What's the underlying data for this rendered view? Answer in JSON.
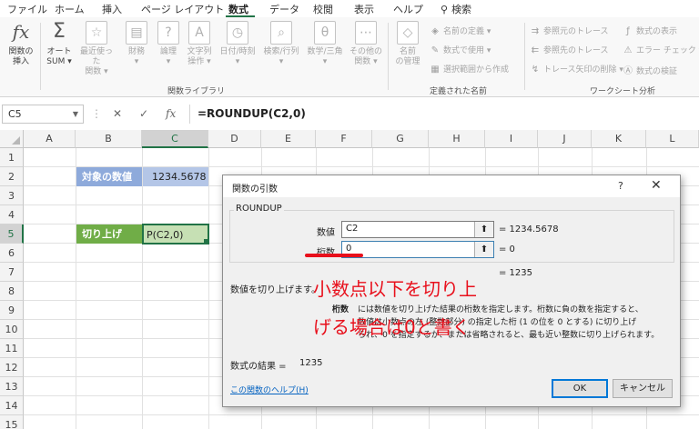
{
  "menu": {
    "tabs": [
      "ファイル",
      "ホーム",
      "挿入",
      "ページ レイアウト",
      "数式",
      "データ",
      "校閲",
      "表示",
      "ヘルプ"
    ],
    "active_tab": "数式",
    "search_label": "検索"
  },
  "ribbon": {
    "insert_function": "関数の\n挿入",
    "autosum": "オート\nSUM ▾",
    "recent": "最近使った\n関数 ▾",
    "financial": "財務\n▾",
    "logical": "論理\n▾",
    "text": "文字列\n操作 ▾",
    "datetime": "日付/時刻\n▾",
    "lookup": "検索/行列\n▾",
    "math": "数学/三角\n▾",
    "more": "その他の\n関数 ▾",
    "library_label": "関数ライブラリ",
    "name_manager": "名前\nの管理",
    "define_name": "名前の定義 ▾",
    "use_in_formula": "数式で使用 ▾",
    "create_from_selection": "選択範囲から作成",
    "defined_names_label": "定義された名前",
    "trace_precedents": "参照元のトレース",
    "trace_dependents": "参照先のトレース",
    "remove_arrows": "トレース矢印の削除 ▾",
    "show_formulas": "数式の表示",
    "error_checking": "エラー チェック ▾",
    "evaluate_formula": "数式の検証",
    "auditing_label": "ワークシート分析"
  },
  "formula_bar": {
    "name_box": "C5",
    "cancel": "✕",
    "enter": "✓",
    "fx": "fx",
    "formula": "=ROUNDUP(C2,0)"
  },
  "grid": {
    "columns": [
      "A",
      "B",
      "C",
      "D",
      "E",
      "F",
      "G",
      "H",
      "I",
      "J",
      "K",
      "L"
    ],
    "rows": [
      "1",
      "2",
      "3",
      "4",
      "5",
      "6",
      "7",
      "8",
      "9",
      "10",
      "11",
      "12",
      "13",
      "14",
      "15"
    ],
    "b2": "対象の数値",
    "c2": "1234.5678",
    "b5": "切り上げ",
    "c5": "P(C2,0)"
  },
  "dialog": {
    "title": "関数の引数",
    "help": "?",
    "close": "✕",
    "function_name": "ROUNDUP",
    "arg1_label": "数値",
    "arg1_value": "C2",
    "arg1_result": "=  1234.5678",
    "arg2_label": "桁数",
    "arg2_value": "0",
    "arg2_result": "=  0",
    "overall_result": "=  1235",
    "description": "数値を切り上げます。",
    "arg_desc_name": "桁数",
    "arg_desc_line1": "には数値を切り上げた結果の桁数を指定します。桁数に負の数を指定すると、",
    "arg_desc_line2": "数値は小数点の左 (整数部分) の指定した桁 (1 の位を 0 とする) に切り上げ",
    "arg_desc_line3": "られ、0 を指定するか、または省略されると、最も近い整数に切り上げられます。",
    "formula_result_label": "数式の結果 =",
    "formula_result_value": "1235",
    "help_link": "この関数のヘルプ(H)",
    "ok": "OK",
    "cancel": "キャンセル"
  },
  "annotation": {
    "line1": "小数点以下を切り上",
    "line2": "げる場合は0と書く",
    "color": "#e8101c"
  }
}
